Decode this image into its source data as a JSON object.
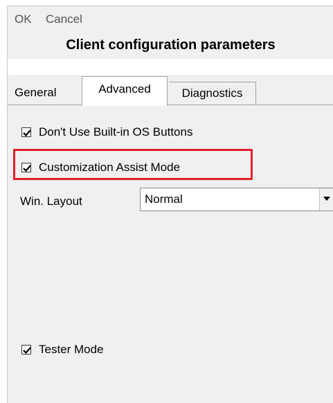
{
  "menu": {
    "ok_label": "OK",
    "cancel_label": "Cancel"
  },
  "dialog": {
    "title": "Client configuration parameters"
  },
  "tabs": [
    {
      "label": "General",
      "active": false
    },
    {
      "label": "Advanced",
      "active": true
    },
    {
      "label": "Diagnostics",
      "active": false
    }
  ],
  "advanced": {
    "dont_use_builtin_os_buttons": {
      "label": "Don't Use Built-in OS Buttons",
      "checked": true
    },
    "customization_assist_mode": {
      "label": "Customization Assist Mode",
      "checked": true
    },
    "win_layout": {
      "label": "Win. Layout",
      "value": "Normal"
    },
    "tester_mode": {
      "label": "Tester Mode",
      "checked": true
    }
  },
  "colors": {
    "highlight": "#e0202a",
    "panel_bg": "#f0f0f0"
  }
}
